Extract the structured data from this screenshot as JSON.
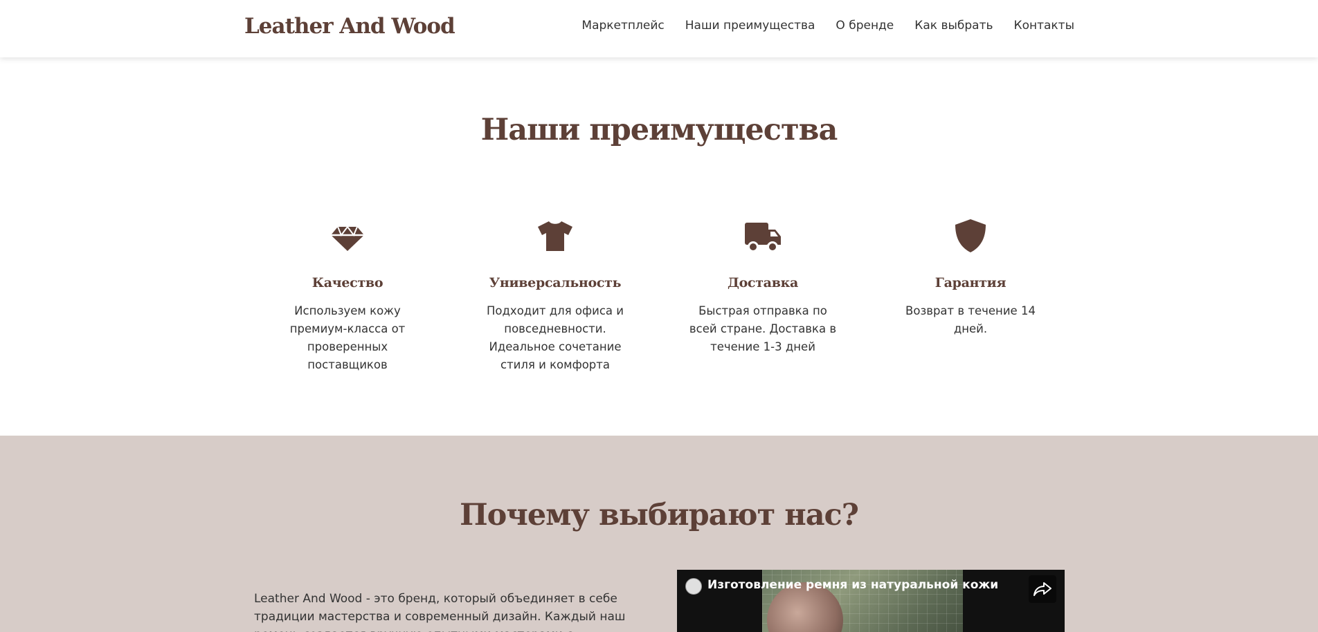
{
  "header": {
    "logo": "Leather And Wood",
    "nav": [
      "Маркетплейс",
      "Наши преимущества",
      "О бренде",
      "Как выбрать",
      "Контакты"
    ]
  },
  "advantages": {
    "title": "Наши преимущества",
    "items": [
      {
        "icon": "gem-icon",
        "title": "Качество",
        "desc": "Используем кожу премиум-класса от проверенных поставщиков"
      },
      {
        "icon": "tshirt-icon",
        "title": "Универсальность",
        "desc": "Подходит для офиса и повседневности. Идеальное сочетание стиля и комфорта"
      },
      {
        "icon": "truck-icon",
        "title": "Доставка",
        "desc": "Быстрая отправка по всей стране. Доставка в течение 1-3 дней"
      },
      {
        "icon": "shield-icon",
        "title": "Гарантия",
        "desc": "Возврат в течение 14 дней."
      }
    ]
  },
  "why": {
    "title": "Почему выбирают нас?",
    "text": "Leather And Wood - это бренд, который объединяет в себе традиции мастерства и современный дизайн. Каждый наш ремень создается вручную опытными мастерами с многолетним опытом работы с",
    "video": {
      "title": "Изготовление ремня из натуральной кожи",
      "share_icon": "share-icon"
    }
  },
  "colors": {
    "brand_brown": "#5d4037",
    "section_bg": "#d7ccc8"
  }
}
